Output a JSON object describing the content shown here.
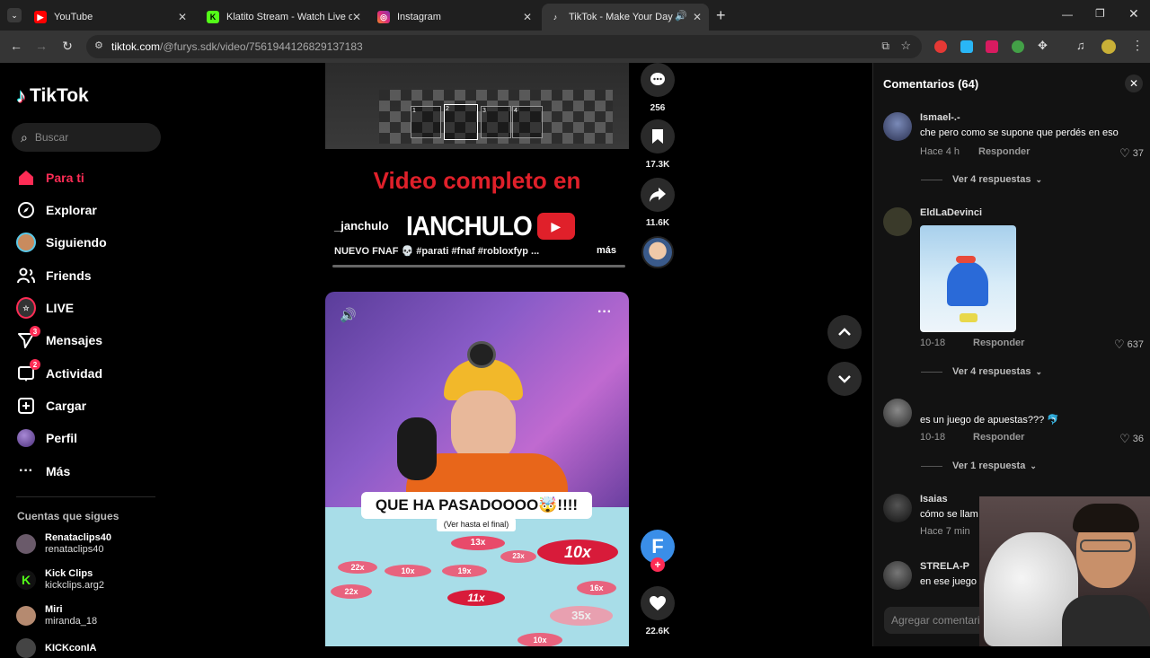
{
  "browser": {
    "tabs": [
      {
        "title": "YouTube",
        "active": false
      },
      {
        "title": "Klatito Stream - Watch Live on K",
        "active": false
      },
      {
        "title": "Instagram",
        "active": false
      },
      {
        "title": "TikTok - Make Your Day",
        "active": true
      }
    ],
    "new_tab": "+",
    "url_host": "tiktok.com",
    "url_path": "/@furys.sdk/video/7561944126829137183"
  },
  "sidebar": {
    "logo": "TikTok",
    "search_placeholder": "Buscar",
    "items": [
      {
        "label": "Para ti",
        "icon": "home-icon"
      },
      {
        "label": "Explorar",
        "icon": "compass-icon"
      },
      {
        "label": "Siguiendo",
        "icon": "avatar-icon"
      },
      {
        "label": "Friends",
        "icon": "friends-icon"
      },
      {
        "label": "LIVE",
        "icon": "live-icon"
      },
      {
        "label": "Mensajes",
        "icon": "messages-icon",
        "badge": "3"
      },
      {
        "label": "Actividad",
        "icon": "activity-icon",
        "badge": "2"
      },
      {
        "label": "Cargar",
        "icon": "upload-icon"
      },
      {
        "label": "Perfil",
        "icon": "profile-icon"
      },
      {
        "label": "Más",
        "icon": "more-icon"
      }
    ],
    "following_header": "Cuentas que sigues",
    "following": [
      {
        "name": "Renataclips40",
        "handle": "renataclips40"
      },
      {
        "name": "Kick Clips",
        "handle": "kickclips.arg2"
      },
      {
        "name": "Miri",
        "handle": "miranda_18"
      },
      {
        "name": "KICKconIA",
        "handle": ""
      }
    ]
  },
  "video_top": {
    "promo_text": "Video completo en",
    "author": "_janchulo",
    "channel_banner": "IANCHULO",
    "caption": "NUEVO FNAF 💀 #parati #fnaf #robloxfyp ...",
    "more": "más",
    "slots": [
      "1",
      "2",
      "3",
      "4"
    ]
  },
  "actions_top": {
    "comments": "256",
    "saves": "17.3K",
    "shares": "11.6K"
  },
  "video_main": {
    "overlay_title": "QUE HA PASADOOOO🤯!!!!",
    "overlay_sub": "(Ver hasta el final)",
    "multipliers": [
      "13x",
      "10x",
      "22x",
      "10x",
      "19x",
      "23x",
      "22x",
      "11x",
      "16x",
      "35x",
      "10x"
    ],
    "likes": "22.6K"
  },
  "comments": {
    "title": "Comentarios (64)",
    "add_placeholder": "Agregar comentario...",
    "reply_label": "Responder",
    "items": [
      {
        "user": "Ismael-.-",
        "text": "che pero como se supone que perdés en eso",
        "time": "Hace 4 h",
        "likes": "37",
        "replies": "Ver 4 respuestas"
      },
      {
        "user": "EldLaDevinci",
        "text": "",
        "time": "10-18",
        "likes": "637",
        "replies": "Ver 4 respuestas"
      },
      {
        "user": "",
        "text": "es un juego de apuestas??? 🐬",
        "time": "10-18",
        "likes": "36",
        "replies": "Ver 1 respuesta"
      },
      {
        "user": "Isaias",
        "text": "cómo se llam",
        "time": "Hace 7 min",
        "likes": "",
        "replies": ""
      },
      {
        "user": "STRELA-P",
        "text": "en ese juego",
        "time": "",
        "likes": "",
        "replies": ""
      }
    ]
  },
  "colors": {
    "brand": "#fe2c55",
    "bg": "#000000",
    "panel": "#121212"
  }
}
